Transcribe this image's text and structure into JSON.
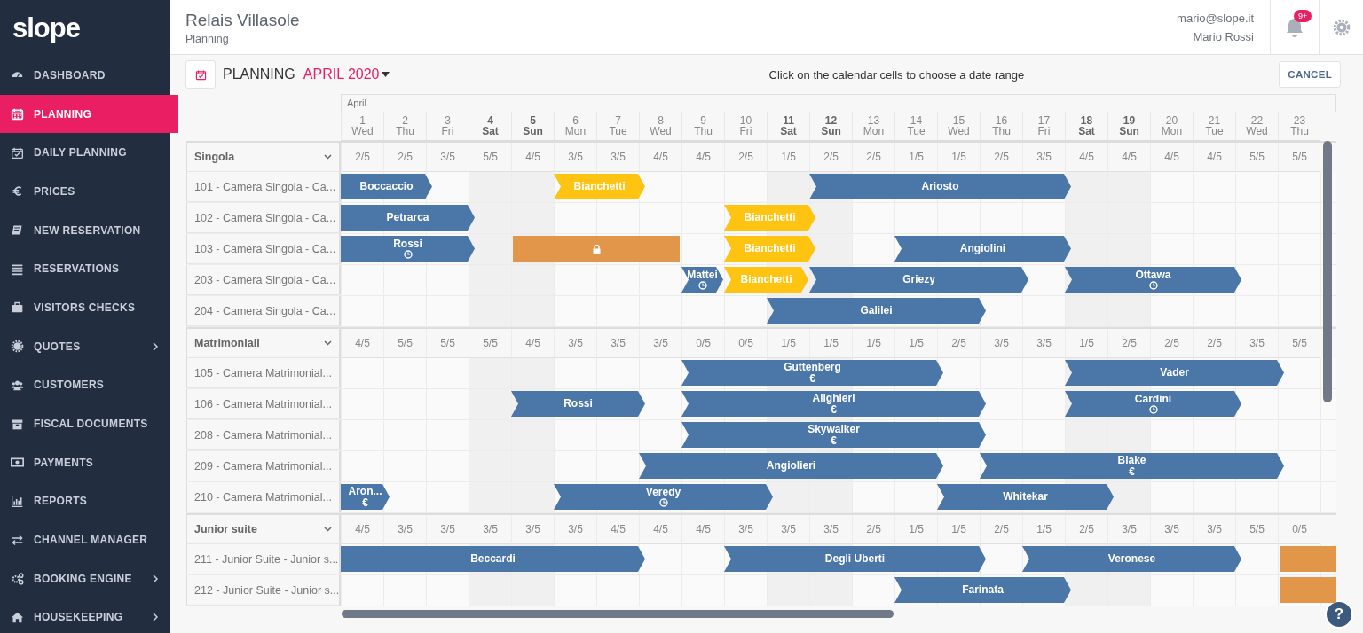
{
  "logo": "slope",
  "sidebar": {
    "items": [
      {
        "label": "DASHBOARD",
        "selected": false,
        "has_submenu": false
      },
      {
        "label": "PLANNING",
        "selected": true,
        "has_submenu": false
      },
      {
        "label": "DAILY PLANNING",
        "selected": false,
        "has_submenu": false
      },
      {
        "label": "PRICES",
        "selected": false,
        "has_submenu": false
      },
      {
        "label": "NEW RESERVATION",
        "selected": false,
        "has_submenu": false
      },
      {
        "label": "RESERVATIONS",
        "selected": false,
        "has_submenu": false
      },
      {
        "label": "VISITORS CHECKS",
        "selected": false,
        "has_submenu": false
      },
      {
        "label": "QUOTES",
        "selected": false,
        "has_submenu": true
      },
      {
        "label": "CUSTOMERS",
        "selected": false,
        "has_submenu": false
      },
      {
        "label": "FISCAL DOCUMENTS",
        "selected": false,
        "has_submenu": false
      },
      {
        "label": "PAYMENTS",
        "selected": false,
        "has_submenu": false
      },
      {
        "label": "REPORTS",
        "selected": false,
        "has_submenu": false
      },
      {
        "label": "CHANNEL MANAGER",
        "selected": false,
        "has_submenu": false
      },
      {
        "label": "BOOKING ENGINE",
        "selected": false,
        "has_submenu": true
      },
      {
        "label": "HOUSEKEEPING",
        "selected": false,
        "has_submenu": true
      }
    ]
  },
  "header": {
    "hotel": "Relais Villasole",
    "page": "Planning",
    "email": "mario@slope.it",
    "user": "Mario Rossi",
    "notifications": "9+"
  },
  "toolbar": {
    "title": "PLANNING",
    "month": "APRIL 2020",
    "hint": "Click on the calendar cells to choose a date range",
    "cancel": "CANCEL"
  },
  "planner": {
    "month_label": "April",
    "days": [
      {
        "day": "1",
        "weekday": "Wed",
        "weekend": false
      },
      {
        "day": "2",
        "weekday": "Thu",
        "weekend": false
      },
      {
        "day": "3",
        "weekday": "Fri",
        "weekend": false
      },
      {
        "day": "4",
        "weekday": "Sat",
        "weekend": true
      },
      {
        "day": "5",
        "weekday": "Sun",
        "weekend": true
      },
      {
        "day": "6",
        "weekday": "Mon",
        "weekend": false
      },
      {
        "day": "7",
        "weekday": "Tue",
        "weekend": false
      },
      {
        "day": "8",
        "weekday": "Wed",
        "weekend": false
      },
      {
        "day": "9",
        "weekday": "Thu",
        "weekend": false
      },
      {
        "day": "10",
        "weekday": "Fri",
        "weekend": false
      },
      {
        "day": "11",
        "weekday": "Sat",
        "weekend": true
      },
      {
        "day": "12",
        "weekday": "Sun",
        "weekend": true
      },
      {
        "day": "13",
        "weekday": "Mon",
        "weekend": false
      },
      {
        "day": "14",
        "weekday": "Tue",
        "weekend": false
      },
      {
        "day": "15",
        "weekday": "Wed",
        "weekend": false
      },
      {
        "day": "16",
        "weekday": "Thu",
        "weekend": false
      },
      {
        "day": "17",
        "weekday": "Fri",
        "weekend": false
      },
      {
        "day": "18",
        "weekday": "Sat",
        "weekend": true
      },
      {
        "day": "19",
        "weekday": "Sun",
        "weekend": true
      },
      {
        "day": "20",
        "weekday": "Mon",
        "weekend": false
      },
      {
        "day": "21",
        "weekday": "Tue",
        "weekend": false
      },
      {
        "day": "22",
        "weekday": "Wed",
        "weekend": false
      },
      {
        "day": "23",
        "weekday": "Thu",
        "weekend": false
      }
    ],
    "groups": [
      {
        "name": "Singola",
        "expanded": true,
        "availability": [
          "2/5",
          "2/5",
          "3/5",
          "5/5",
          "4/5",
          "3/5",
          "3/5",
          "4/5",
          "4/5",
          "2/5",
          "1/5",
          "2/5",
          "2/5",
          "1/5",
          "1/5",
          "2/5",
          "3/5",
          "4/5",
          "4/5",
          "4/5",
          "4/5",
          "5/5",
          "5/5"
        ],
        "rooms": [
          {
            "name": "101 - Camera Singola - Ca...",
            "nights": [
              {
                "kind": "confirmed",
                "guest": "Boccaccio"
              },
              {
                "kind": "stay"
              },
              {
                "kind": "free"
              },
              {
                "kind": "free"
              },
              {
                "kind": "free"
              },
              {
                "kind": "option",
                "guest": "Bianchetti"
              },
              {
                "kind": "stay"
              },
              {
                "kind": "free"
              },
              {
                "kind": "free"
              },
              {
                "kind": "free"
              },
              {
                "kind": "free"
              },
              {
                "kind": "confirmed",
                "guest": "Ariosto"
              },
              {
                "kind": "stay"
              },
              {
                "kind": "stay"
              },
              {
                "kind": "stay"
              },
              {
                "kind": "stay"
              },
              {
                "kind": "stay"
              },
              {
                "kind": "free"
              },
              {
                "kind": "free"
              },
              {
                "kind": "free"
              },
              {
                "kind": "free"
              },
              {
                "kind": "free"
              },
              {
                "kind": "free"
              }
            ]
          },
          {
            "name": "102 - Camera Singola - Ca...",
            "nights": [
              {
                "kind": "confirmed",
                "guest": "Petrarca"
              },
              {
                "kind": "stay"
              },
              {
                "kind": "stay"
              },
              {
                "kind": "free"
              },
              {
                "kind": "free"
              },
              {
                "kind": "free"
              },
              {
                "kind": "free"
              },
              {
                "kind": "free"
              },
              {
                "kind": "free"
              },
              {
                "kind": "option",
                "guest": "Bianchetti"
              },
              {
                "kind": "stay"
              },
              {
                "kind": "free"
              },
              {
                "kind": "free"
              },
              {
                "kind": "free"
              },
              {
                "kind": "free"
              },
              {
                "kind": "free"
              },
              {
                "kind": "free"
              },
              {
                "kind": "free"
              },
              {
                "kind": "free"
              },
              {
                "kind": "free"
              },
              {
                "kind": "free"
              },
              {
                "kind": "free"
              },
              {
                "kind": "free"
              }
            ]
          },
          {
            "name": "103 - Camera Singola - Ca...",
            "nights": [
              {
                "kind": "confirmed",
                "guest": "Rossi",
                "pending": true
              },
              {
                "kind": "stay"
              },
              {
                "kind": "stay"
              },
              {
                "kind": "free"
              },
              {
                "kind": "block"
              },
              {
                "kind": "stay"
              },
              {
                "kind": "stay"
              },
              {
                "kind": "stay"
              },
              {
                "kind": "free"
              },
              {
                "kind": "option",
                "guest": "Bianchetti"
              },
              {
                "kind": "stay"
              },
              {
                "kind": "free"
              },
              {
                "kind": "free"
              },
              {
                "kind": "confirmed",
                "guest": "Angiolini"
              },
              {
                "kind": "stay"
              },
              {
                "kind": "stay"
              },
              {
                "kind": "stay"
              },
              {
                "kind": "free"
              },
              {
                "kind": "free"
              },
              {
                "kind": "free"
              },
              {
                "kind": "free"
              },
              {
                "kind": "free"
              },
              {
                "kind": "free"
              }
            ]
          },
          {
            "name": "203 - Camera Singola - Ca...",
            "nights": [
              {
                "kind": "free"
              },
              {
                "kind": "free"
              },
              {
                "kind": "free"
              },
              {
                "kind": "free"
              },
              {
                "kind": "free"
              },
              {
                "kind": "free"
              },
              {
                "kind": "free"
              },
              {
                "kind": "free"
              },
              {
                "kind": "confirmed",
                "guest": "Mattei",
                "pending": true
              },
              {
                "kind": "option",
                "guest": "Bianchetti"
              },
              {
                "kind": "stay"
              },
              {
                "kind": "confirmed",
                "guest": "Griezy"
              },
              {
                "kind": "stay"
              },
              {
                "kind": "stay"
              },
              {
                "kind": "stay"
              },
              {
                "kind": "stay"
              },
              {
                "kind": "free"
              },
              {
                "kind": "confirmed",
                "guest": "Ottawa",
                "pending": true
              },
              {
                "kind": "stay"
              },
              {
                "kind": "stay"
              },
              {
                "kind": "stay"
              },
              {
                "kind": "free"
              },
              {
                "kind": "free"
              }
            ]
          },
          {
            "name": "204 - Camera Singola - Ca...",
            "nights": [
              {
                "kind": "free"
              },
              {
                "kind": "free"
              },
              {
                "kind": "free"
              },
              {
                "kind": "free"
              },
              {
                "kind": "free"
              },
              {
                "kind": "free"
              },
              {
                "kind": "free"
              },
              {
                "kind": "free"
              },
              {
                "kind": "free"
              },
              {
                "kind": "free"
              },
              {
                "kind": "confirmed",
                "guest": "Galilei"
              },
              {
                "kind": "stay"
              },
              {
                "kind": "stay"
              },
              {
                "kind": "stay"
              },
              {
                "kind": "stay"
              },
              {
                "kind": "free"
              },
              {
                "kind": "free"
              },
              {
                "kind": "free"
              },
              {
                "kind": "free"
              },
              {
                "kind": "free"
              },
              {
                "kind": "free"
              },
              {
                "kind": "free"
              },
              {
                "kind": "free"
              }
            ]
          }
        ]
      },
      {
        "name": "Matrimoniali",
        "expanded": true,
        "availability": [
          "4/5",
          "5/5",
          "5/5",
          "5/5",
          "4/5",
          "3/5",
          "3/5",
          "3/5",
          "0/5",
          "0/5",
          "1/5",
          "1/5",
          "1/5",
          "1/5",
          "2/5",
          "3/5",
          "3/5",
          "1/5",
          "2/5",
          "2/5",
          "2/5",
          "3/5",
          "5/5"
        ],
        "rooms": [
          {
            "name": "105 - Camera Matrimonial...",
            "nights": [
              {
                "kind": "free"
              },
              {
                "kind": "free"
              },
              {
                "kind": "free"
              },
              {
                "kind": "free"
              },
              {
                "kind": "free"
              },
              {
                "kind": "free"
              },
              {
                "kind": "free"
              },
              {
                "kind": "free"
              },
              {
                "kind": "confirmed",
                "guest": "Guttenberg",
                "mark": "€"
              },
              {
                "kind": "stay"
              },
              {
                "kind": "stay"
              },
              {
                "kind": "stay"
              },
              {
                "kind": "stay"
              },
              {
                "kind": "stay"
              },
              {
                "kind": "free"
              },
              {
                "kind": "free"
              },
              {
                "kind": "free"
              },
              {
                "kind": "confirmed",
                "guest": "Vader"
              },
              {
                "kind": "stay"
              },
              {
                "kind": "stay"
              },
              {
                "kind": "stay"
              },
              {
                "kind": "stay"
              },
              {
                "kind": "free"
              }
            ]
          },
          {
            "name": "106 - Camera Matrimonial...",
            "nights": [
              {
                "kind": "free"
              },
              {
                "kind": "free"
              },
              {
                "kind": "free"
              },
              {
                "kind": "free"
              },
              {
                "kind": "confirmed",
                "guest": "Rossi"
              },
              {
                "kind": "stay"
              },
              {
                "kind": "stay"
              },
              {
                "kind": "free"
              },
              {
                "kind": "confirmed",
                "guest": "Alighieri",
                "mark": "€"
              },
              {
                "kind": "stay"
              },
              {
                "kind": "stay"
              },
              {
                "kind": "stay"
              },
              {
                "kind": "stay"
              },
              {
                "kind": "stay"
              },
              {
                "kind": "stay"
              },
              {
                "kind": "free"
              },
              {
                "kind": "free"
              },
              {
                "kind": "confirmed",
                "guest": "Cardini",
                "pending": true
              },
              {
                "kind": "stay"
              },
              {
                "kind": "stay"
              },
              {
                "kind": "stay"
              },
              {
                "kind": "free"
              },
              {
                "kind": "free"
              }
            ]
          },
          {
            "name": "208 - Camera Matrimonial...",
            "nights": [
              {
                "kind": "free"
              },
              {
                "kind": "free"
              },
              {
                "kind": "free"
              },
              {
                "kind": "free"
              },
              {
                "kind": "free"
              },
              {
                "kind": "free"
              },
              {
                "kind": "free"
              },
              {
                "kind": "free"
              },
              {
                "kind": "confirmed",
                "guest": "Skywalker",
                "mark": "€"
              },
              {
                "kind": "stay"
              },
              {
                "kind": "stay"
              },
              {
                "kind": "stay"
              },
              {
                "kind": "stay"
              },
              {
                "kind": "stay"
              },
              {
                "kind": "stay"
              },
              {
                "kind": "free"
              },
              {
                "kind": "free"
              },
              {
                "kind": "free"
              },
              {
                "kind": "free"
              },
              {
                "kind": "free"
              },
              {
                "kind": "free"
              },
              {
                "kind": "free"
              },
              {
                "kind": "free"
              }
            ]
          },
          {
            "name": "209 - Camera Matrimonial...",
            "nights": [
              {
                "kind": "free"
              },
              {
                "kind": "free"
              },
              {
                "kind": "free"
              },
              {
                "kind": "free"
              },
              {
                "kind": "free"
              },
              {
                "kind": "free"
              },
              {
                "kind": "free"
              },
              {
                "kind": "confirmed",
                "guest": "Angiolieri"
              },
              {
                "kind": "stay"
              },
              {
                "kind": "stay"
              },
              {
                "kind": "stay"
              },
              {
                "kind": "stay"
              },
              {
                "kind": "stay"
              },
              {
                "kind": "stay"
              },
              {
                "kind": "free"
              },
              {
                "kind": "confirmed",
                "guest": "Blake",
                "mark": "€"
              },
              {
                "kind": "stay"
              },
              {
                "kind": "stay"
              },
              {
                "kind": "stay"
              },
              {
                "kind": "stay"
              },
              {
                "kind": "stay"
              },
              {
                "kind": "stay"
              },
              {
                "kind": "free"
              }
            ]
          },
          {
            "name": "210 - Camera Matrimonial...",
            "nights": [
              {
                "kind": "confirmed",
                "guest": "Aron...",
                "mark": "€"
              },
              {
                "kind": "free"
              },
              {
                "kind": "free"
              },
              {
                "kind": "free"
              },
              {
                "kind": "free"
              },
              {
                "kind": "confirmed",
                "guest": "Veredy",
                "pending": true
              },
              {
                "kind": "stay"
              },
              {
                "kind": "stay"
              },
              {
                "kind": "stay"
              },
              {
                "kind": "stay"
              },
              {
                "kind": "free"
              },
              {
                "kind": "free"
              },
              {
                "kind": "free"
              },
              {
                "kind": "free"
              },
              {
                "kind": "confirmed",
                "guest": "Whitekar"
              },
              {
                "kind": "stay"
              },
              {
                "kind": "stay"
              },
              {
                "kind": "stay"
              },
              {
                "kind": "free"
              },
              {
                "kind": "free"
              },
              {
                "kind": "free"
              },
              {
                "kind": "free"
              },
              {
                "kind": "free"
              }
            ]
          }
        ]
      },
      {
        "name": "Junior suite",
        "expanded": true,
        "availability": [
          "4/5",
          "3/5",
          "3/5",
          "3/5",
          "3/5",
          "3/5",
          "4/5",
          "4/5",
          "4/5",
          "3/5",
          "3/5",
          "3/5",
          "2/5",
          "1/5",
          "1/5",
          "2/5",
          "1/5",
          "2/5",
          "3/5",
          "3/5",
          "3/5",
          "5/5",
          "0/5"
        ],
        "rooms": [
          {
            "name": "211 - Junior Suite - Junior s...",
            "nights": [
              {
                "kind": "confirmed",
                "guest": "Beccardi"
              },
              {
                "kind": "stay"
              },
              {
                "kind": "stay"
              },
              {
                "kind": "stay"
              },
              {
                "kind": "stay"
              },
              {
                "kind": "stay"
              },
              {
                "kind": "stay"
              },
              {
                "kind": "free"
              },
              {
                "kind": "free"
              },
              {
                "kind": "confirmed",
                "guest": "Degli Uberti"
              },
              {
                "kind": "stay"
              },
              {
                "kind": "stay"
              },
              {
                "kind": "stay"
              },
              {
                "kind": "stay"
              },
              {
                "kind": "stay"
              },
              {
                "kind": "free"
              },
              {
                "kind": "confirmed",
                "guest": "Veronese"
              },
              {
                "kind": "stay"
              },
              {
                "kind": "stay"
              },
              {
                "kind": "stay"
              },
              {
                "kind": "stay"
              },
              {
                "kind": "free"
              },
              {
                "kind": "block"
              }
            ]
          },
          {
            "name": "212 - Junior Suite - Junior s...",
            "nights": [
              {
                "kind": "free"
              },
              {
                "kind": "free"
              },
              {
                "kind": "free"
              },
              {
                "kind": "free"
              },
              {
                "kind": "free"
              },
              {
                "kind": "free"
              },
              {
                "kind": "free"
              },
              {
                "kind": "free"
              },
              {
                "kind": "free"
              },
              {
                "kind": "free"
              },
              {
                "kind": "free"
              },
              {
                "kind": "free"
              },
              {
                "kind": "free"
              },
              {
                "kind": "confirmed",
                "guest": "Farinata"
              },
              {
                "kind": "stay"
              },
              {
                "kind": "stay"
              },
              {
                "kind": "stay"
              },
              {
                "kind": "free"
              },
              {
                "kind": "free"
              },
              {
                "kind": "free"
              },
              {
                "kind": "free"
              },
              {
                "kind": "free"
              },
              {
                "kind": "block"
              }
            ]
          }
        ]
      }
    ]
  },
  "help": "?"
}
